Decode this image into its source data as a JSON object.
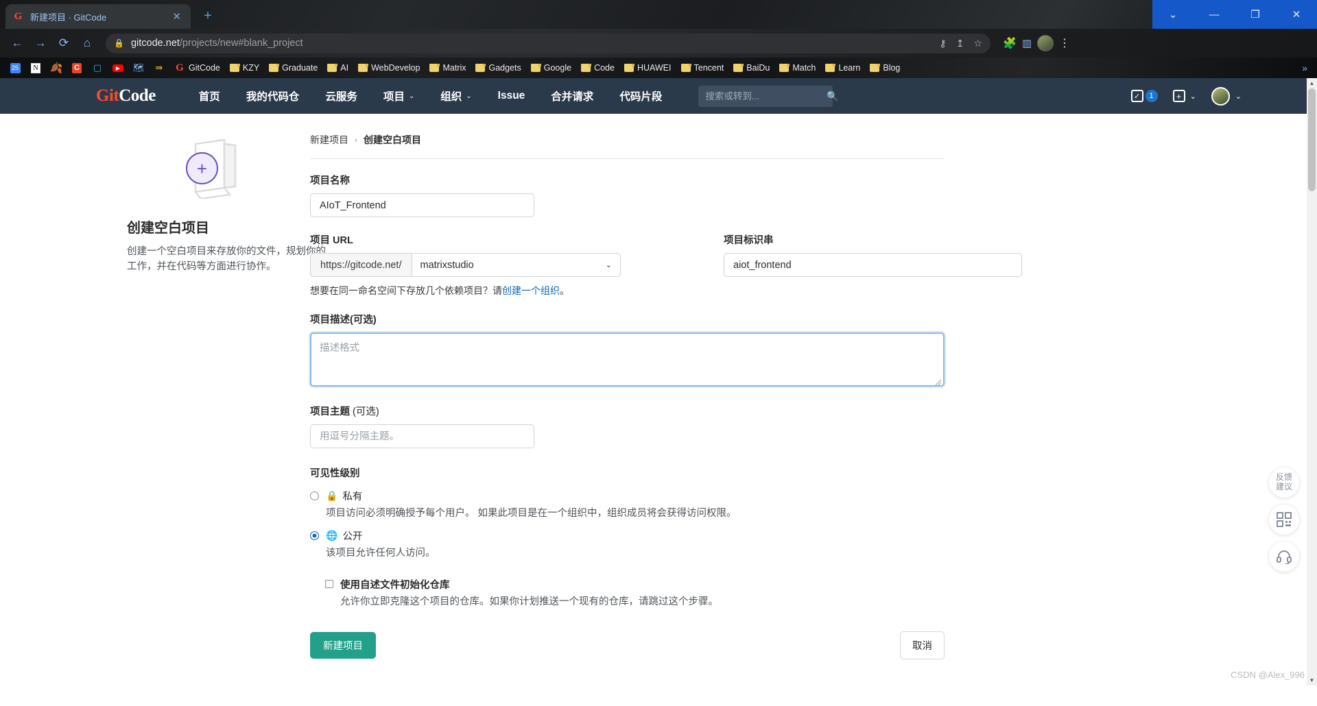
{
  "browser": {
    "tab": {
      "title": "新建项目 · GitCode",
      "favicon": "gitcode-favicon",
      "close": "✕"
    },
    "new_tab": "+",
    "window_controls": {
      "restore_down": "⌄",
      "minimize": "—",
      "maximize": "❐",
      "close": "✕"
    },
    "nav": {
      "back": "←",
      "forward": "→",
      "reload": "⟳",
      "home": "⌂"
    },
    "omnibox": {
      "lock": "🔒",
      "url_host": "gitcode.net",
      "url_path": "/projects/new#blank_project",
      "key_icon": "⚷",
      "share_icon": "↥",
      "star_icon": "☆"
    },
    "toolbar": {
      "extensions": "🧩",
      "side_panel": "▥",
      "profile": "avatar",
      "menu": "⋮"
    },
    "bookmarks": [
      {
        "label": "",
        "icon": "calendar-25"
      },
      {
        "label": "",
        "icon": "notion"
      },
      {
        "label": "",
        "icon": "leaf-green"
      },
      {
        "label": "",
        "icon": "c-red"
      },
      {
        "label": "",
        "icon": "bilibili"
      },
      {
        "label": "",
        "icon": "youtube"
      },
      {
        "label": "",
        "icon": "map-blue"
      },
      {
        "label": "",
        "icon": "yellow-curve"
      },
      {
        "label": "GitCode",
        "icon": "gitcode"
      },
      {
        "label": "KZY",
        "icon": "folder"
      },
      {
        "label": "Graduate",
        "icon": "folder"
      },
      {
        "label": "AI",
        "icon": "folder"
      },
      {
        "label": "WebDevelop",
        "icon": "folder"
      },
      {
        "label": "Matrix",
        "icon": "folder"
      },
      {
        "label": "Gadgets",
        "icon": "folder"
      },
      {
        "label": "Google",
        "icon": "folder"
      },
      {
        "label": "Code",
        "icon": "folder"
      },
      {
        "label": "HUAWEI",
        "icon": "folder"
      },
      {
        "label": "Tencent",
        "icon": "folder"
      },
      {
        "label": "BaiDu",
        "icon": "folder"
      },
      {
        "label": "Match",
        "icon": "folder"
      },
      {
        "label": "Learn",
        "icon": "folder"
      },
      {
        "label": "Blog",
        "icon": "folder"
      }
    ],
    "bookmarks_overflow": "»"
  },
  "site": {
    "logo": {
      "g": "G",
      "it": "it",
      "code": "Code"
    },
    "menu": [
      {
        "label": "首页",
        "caret": ""
      },
      {
        "label": "我的代码仓",
        "caret": ""
      },
      {
        "label": "云服务",
        "caret": ""
      },
      {
        "label": "项目",
        "caret": "⌄"
      },
      {
        "label": "组织",
        "caret": "⌄"
      },
      {
        "label": "Issue",
        "caret": ""
      },
      {
        "label": "合并请求",
        "caret": ""
      },
      {
        "label": "代码片段",
        "caret": ""
      }
    ],
    "search": {
      "placeholder": "搜索或转到...",
      "value": "",
      "icon": "search-icon"
    },
    "todo": {
      "icon": "todo-list-icon",
      "count": "1"
    },
    "create": {
      "icon": "plus-icon",
      "caret": "⌄"
    },
    "user": {
      "avatar": "user-avatar",
      "caret": "⌄"
    }
  },
  "left": {
    "illustration": "open-folder-plus-illustration",
    "plus": "+",
    "title": "创建空白项目",
    "desc": "创建一个空白项目来存放你的文件，规划你的工作，并在代码等方面进行协作。"
  },
  "form": {
    "breadcrumb": {
      "parent": "新建项目",
      "sep": "›",
      "current": "创建空白项目"
    },
    "name": {
      "label": "项目名称",
      "value": "AIoT_Frontend",
      "placeholder": ""
    },
    "url": {
      "label": "项目 URL",
      "prefix": "https://gitcode.net/",
      "namespace": "matrixstudio",
      "caret": "⌄"
    },
    "slug": {
      "label": "项目标识串",
      "value": "aiot_frontend",
      "placeholder": ""
    },
    "hint": {
      "text": "想要在同一命名空间下存放几个依赖项目？请",
      "link": "创建一个组织",
      "suffix": "。"
    },
    "description": {
      "label": "项目描述(可选)",
      "value": "",
      "placeholder": "描述格式"
    },
    "topics": {
      "label_bold": "项目主题",
      "label_light": " (可选)",
      "value": "",
      "placeholder": "用逗号分隔主题。"
    },
    "visibility": {
      "label": "可见性级别",
      "options": [
        {
          "id": "private",
          "icon": "lock-icon",
          "glyph": "🔒",
          "name": "私有",
          "desc": "项目访问必须明确授予每个用户。 如果此项目是在一个组织中，组织成员将会获得访问权限。",
          "selected": false
        },
        {
          "id": "public",
          "icon": "globe-icon",
          "glyph": "🌐",
          "name": "公开",
          "desc": "该项目允许任何人访问。",
          "selected": true
        }
      ]
    },
    "readme": {
      "title": "使用自述文件初始化仓库",
      "desc": "允许你立即克隆这个项目的仓库。如果你计划推送一个现有的仓库，请跳过这个步骤。",
      "checked": false
    },
    "submit": "新建项目",
    "cancel": "取消"
  },
  "floating": [
    {
      "id": "feedback",
      "line1": "反馈",
      "line2": "建议",
      "icon": "feedback-icon"
    },
    {
      "id": "qrcode",
      "line1": "",
      "line2": "",
      "icon": "qrcode-icon"
    },
    {
      "id": "support",
      "line1": "",
      "line2": "",
      "icon": "headset-icon"
    }
  ],
  "watermark": "CSDN @Alex_996"
}
